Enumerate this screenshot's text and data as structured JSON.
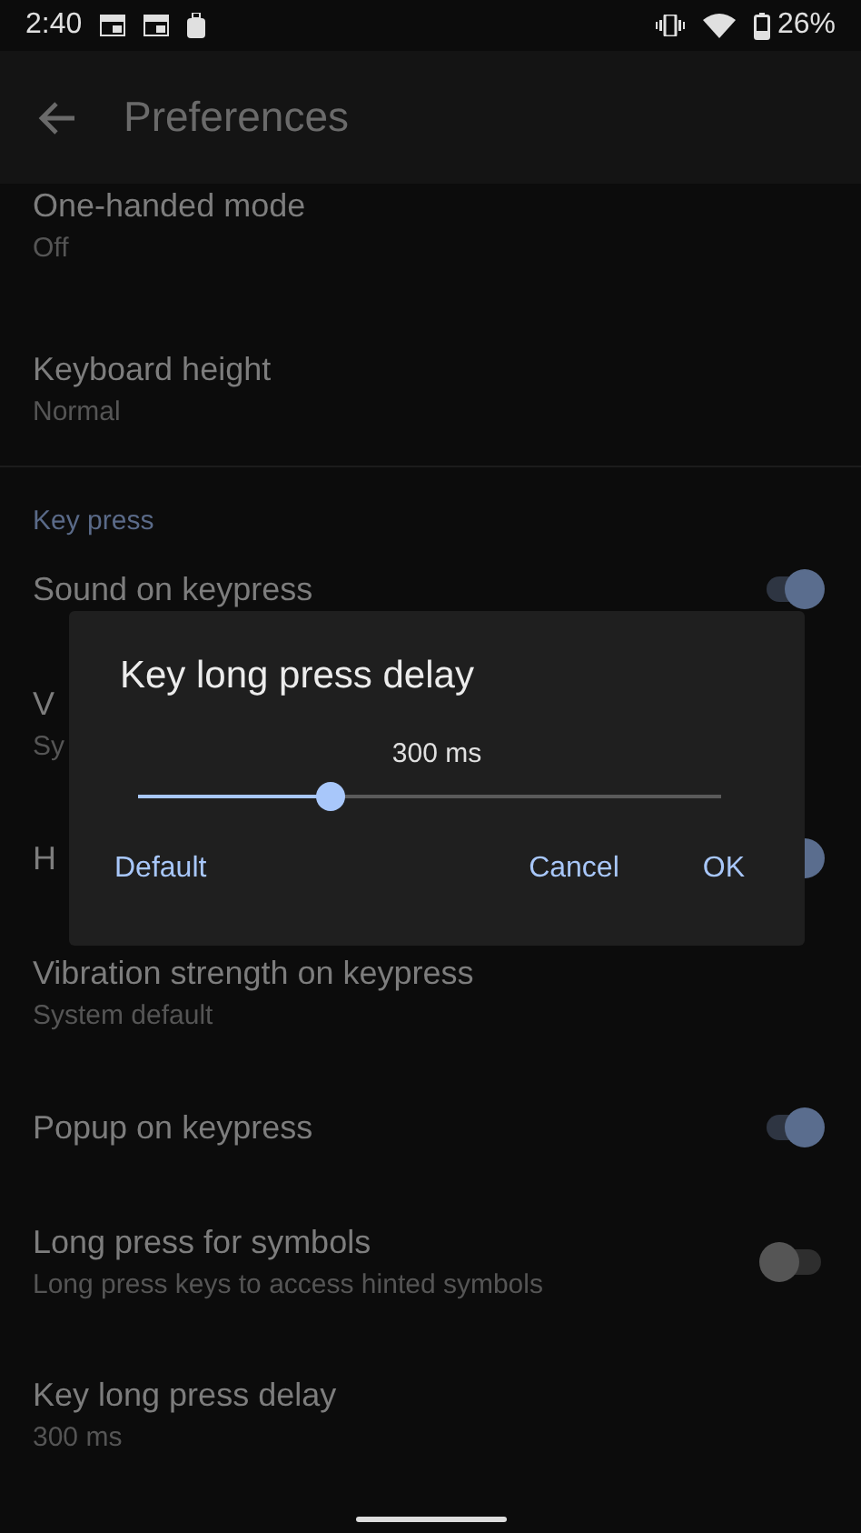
{
  "status_bar": {
    "time": "2:40",
    "battery": "26%"
  },
  "app_bar": {
    "title": "Preferences"
  },
  "settings": [
    {
      "kind": "text",
      "title": "One-handed mode",
      "subtitle": "Off"
    },
    {
      "kind": "text",
      "title": "Keyboard height",
      "subtitle": "Normal"
    },
    {
      "kind": "header",
      "title": "Key press"
    },
    {
      "kind": "toggle",
      "title": "Sound on keypress",
      "on": true
    },
    {
      "kind": "text",
      "title": "V",
      "subtitle": "Sy"
    },
    {
      "kind": "toggle",
      "title": "H",
      "on": true
    },
    {
      "kind": "text",
      "title": "Vibration strength on keypress",
      "subtitle": "System default"
    },
    {
      "kind": "toggle",
      "title": "Popup on keypress",
      "on": true
    },
    {
      "kind": "toggle",
      "title": "Long press for symbols",
      "subtitle": "Long press keys to access hinted symbols",
      "on": false
    },
    {
      "kind": "text",
      "title": "Key long press delay",
      "subtitle": "300 ms"
    }
  ],
  "dialog": {
    "title": "Key long press delay",
    "value": "300 ms",
    "slider": {
      "level": 0.33
    },
    "buttons_left": [
      "Default"
    ],
    "buttons_right": [
      "Cancel",
      "OK"
    ]
  }
}
